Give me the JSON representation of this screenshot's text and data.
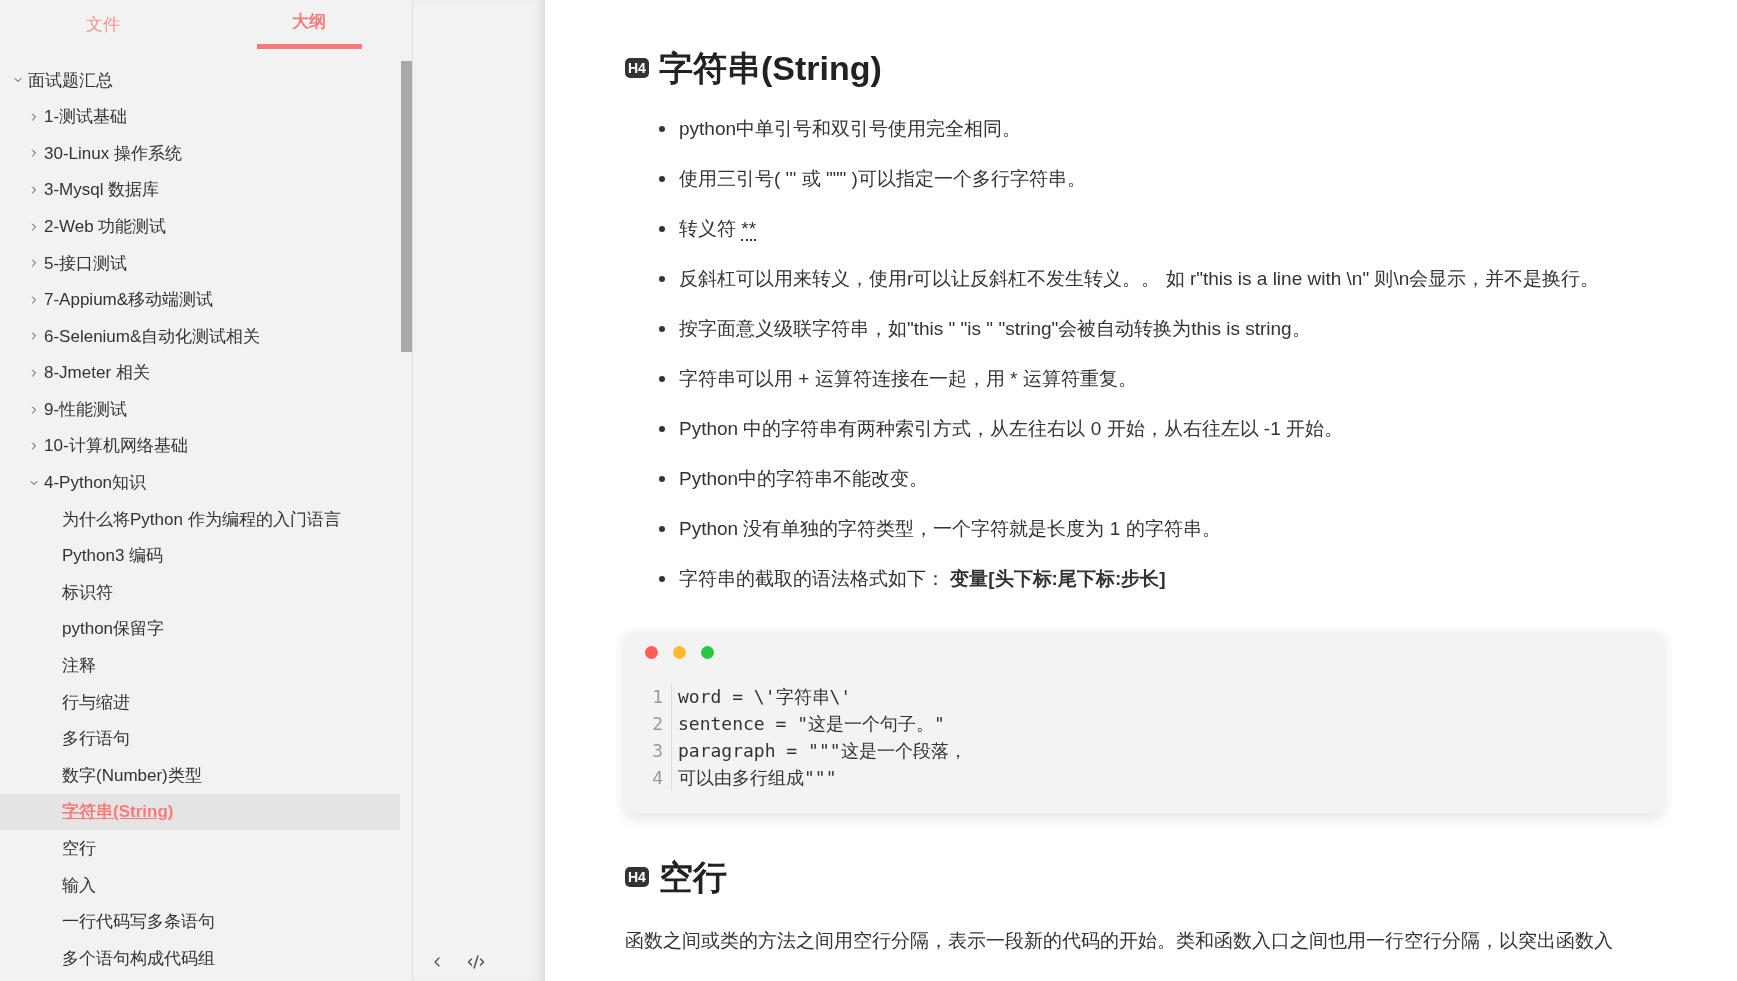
{
  "sidebar": {
    "tabs": [
      {
        "label": "文件",
        "selected": false
      },
      {
        "label": "大纲",
        "selected": true
      }
    ],
    "outline": [
      {
        "label": "面试题汇总",
        "expanded": true,
        "selected": false,
        "children": [
          {
            "label": "1-测试基础",
            "expanded": false,
            "selected": false
          },
          {
            "label": "30-Linux 操作系统",
            "expanded": false,
            "selected": false
          },
          {
            "label": "3-Mysql 数据库",
            "expanded": false,
            "selected": false
          },
          {
            "label": "2-Web 功能测试",
            "expanded": false,
            "selected": false
          },
          {
            "label": "5-接口测试",
            "expanded": false,
            "selected": false
          },
          {
            "label": "7-Appium&移动端测试",
            "expanded": false,
            "selected": false
          },
          {
            "label": "6-Selenium&自动化测试相关",
            "expanded": false,
            "selected": false
          },
          {
            "label": "8-Jmeter 相关",
            "expanded": false,
            "selected": false
          },
          {
            "label": "9-性能测试",
            "expanded": false,
            "selected": false
          },
          {
            "label": "10-计算机网络基础",
            "expanded": false,
            "selected": false
          },
          {
            "label": "4-Python知识",
            "expanded": true,
            "selected": false,
            "children": [
              {
                "label": "为什么将Python 作为编程的入门语言",
                "selected": false
              },
              {
                "label": "Python3 编码",
                "selected": false
              },
              {
                "label": "标识符",
                "selected": false
              },
              {
                "label": "python保留字",
                "selected": false
              },
              {
                "label": "注释",
                "selected": false
              },
              {
                "label": "行与缩进",
                "selected": false
              },
              {
                "label": "多行语句",
                "selected": false
              },
              {
                "label": "数字(Number)类型",
                "selected": false
              },
              {
                "label": "字符串(String)",
                "selected": true
              },
              {
                "label": "空行",
                "selected": false
              },
              {
                "label": "输入",
                "selected": false
              },
              {
                "label": "一行代码写多条语句",
                "selected": false
              },
              {
                "label": "多个语句构成代码组",
                "selected": false
              }
            ]
          }
        ]
      }
    ]
  },
  "document": {
    "sections": [
      {
        "badge": "H4",
        "heading": "字符串(String)",
        "bullets": [
          {
            "text": "python中单引号和双引号使用完全相同。"
          },
          {
            "text": "使用三引号( ''' 或 \"\"\" )可以指定一个多行字符串。"
          },
          {
            "text": "转义符 ",
            "annotated": "**"
          },
          {
            "text": "反斜杠可以用来转义，使用r可以让反斜杠不发生转义。。 如 r\"this is a line with \\n\" 则\\n会显示，并不是换行。"
          },
          {
            "text": "按字面意义级联字符串，如\"this \" \"is \" \"string\"会被自动转换为this is string。"
          },
          {
            "text": "字符串可以用 + 运算符连接在一起，用 * 运算符重复。"
          },
          {
            "text": "Python 中的字符串有两种索引方式，从左往右以 0 开始，从右往左以 -1 开始。"
          },
          {
            "text": "Python中的字符串不能改变。"
          },
          {
            "text": "Python 没有单独的字符类型，一个字符就是长度为 1 的字符串。"
          },
          {
            "text": "字符串的截取的语法格式如下： **变量[头下标:尾下标:步长]**"
          }
        ],
        "code": [
          {
            "number": "1",
            "text": "word = \\'字符串\\'"
          },
          {
            "number": "2",
            "text": "sentence = \"这是一个句子。\""
          },
          {
            "number": "3",
            "text": "paragraph = \"\"\"这是一个段落，"
          },
          {
            "number": "4",
            "text": "可以由多行组成\"\"\""
          }
        ]
      },
      {
        "badge": "H4",
        "heading": "空行",
        "paragraph": "函数之间或类的方法之间用空行分隔，表示一段新的代码的开始。类和函数入口之间也用一行空行分隔，以突出函数入"
      }
    ]
  }
}
